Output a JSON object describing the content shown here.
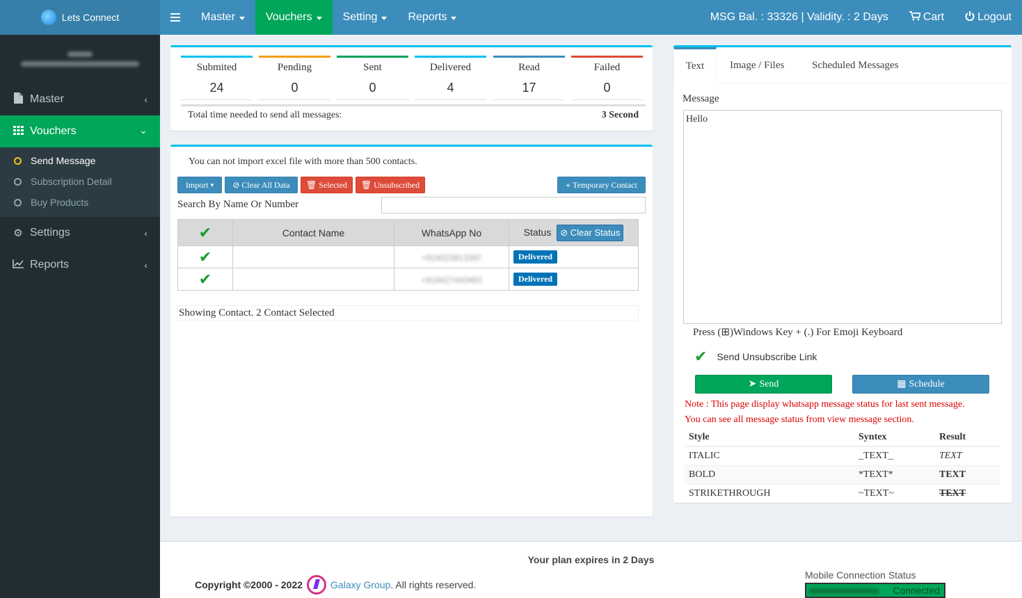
{
  "brand": {
    "name": "Lets Connect"
  },
  "topnav": {
    "menus": [
      "Master",
      "Vouchers",
      "Setting",
      "Reports"
    ],
    "balance": "MSG Bal. : 33326 | Validity. : 2 Days",
    "cart": "Cart",
    "logout": "Logout"
  },
  "sidebar": {
    "master": "Master",
    "vouchers": "Vouchers",
    "sub": [
      "Send Message",
      "Subscription Detail",
      "Buy Products"
    ],
    "settings": "Settings",
    "reports": "Reports"
  },
  "stats": {
    "items": [
      {
        "label": "Submited",
        "value": "24",
        "color": "#00c0ef"
      },
      {
        "label": "Pending",
        "value": "0",
        "color": "#f39c12"
      },
      {
        "label": "Sent",
        "value": "0",
        "color": "#00a65a"
      },
      {
        "label": "Delivered",
        "value": "4",
        "color": "#00c0ef"
      },
      {
        "label": "Read",
        "value": "17",
        "color": "#3c8dbc"
      },
      {
        "label": "Failed",
        "value": "0",
        "color": "#dd4b39"
      }
    ],
    "total_label": "Total time needed to send all messages:",
    "total_value": "3 Second"
  },
  "contacts": {
    "warning": "You can not import excel file with more than 500 contacts.",
    "buttons": {
      "import": "Import",
      "clear_all": "Clear All Data",
      "selected": "Selected",
      "unsubscribed": "Unsubscribed",
      "temporary": "Temporary Contact"
    },
    "search_label": "Search By Name Or Number",
    "columns": [
      "Contact Name",
      "WhatsApp No",
      "Status"
    ],
    "clear_status": "Clear Status",
    "rows": [
      {
        "name": "",
        "number": "+919023913397",
        "status": "Delivered"
      },
      {
        "name": "",
        "number": "+919427443483",
        "status": "Delivered"
      }
    ],
    "showing": "Showing Contact. 2 Contact Selected"
  },
  "message": {
    "tabs": [
      "Text",
      "Image / Files",
      "Scheduled Messages"
    ],
    "label": "Message",
    "text": "Hello",
    "emoji_note": "Press (⊞)Windows Key + (.) For Emoji Keyboard",
    "unsubscribe": "Send Unsubscribe Link",
    "send": "Send",
    "schedule": "Schedule",
    "note1": "Note : This page display whatsapp message status for last sent message.",
    "note2": "You can see all message status from view message section.",
    "style_headers": [
      "Style",
      "Syntex",
      "Result"
    ],
    "styles": [
      {
        "style": "ITALIC",
        "syntax": "_TEXT_",
        "result": "TEXT"
      },
      {
        "style": "BOLD",
        "syntax": "*TEXT*",
        "result": "TEXT"
      },
      {
        "style": "STRIKETHROUGH",
        "syntax": "~TEXT~",
        "result": "TEXT"
      }
    ]
  },
  "footer": {
    "plan": "Your plan expires in 2 Days",
    "copyright": "Copyright ©2000 - 2022",
    "company": "Galaxy Group",
    "rights": ". All rights reserved.",
    "mobile_status_label": "Mobile Connection Status",
    "connected": "Connected"
  }
}
